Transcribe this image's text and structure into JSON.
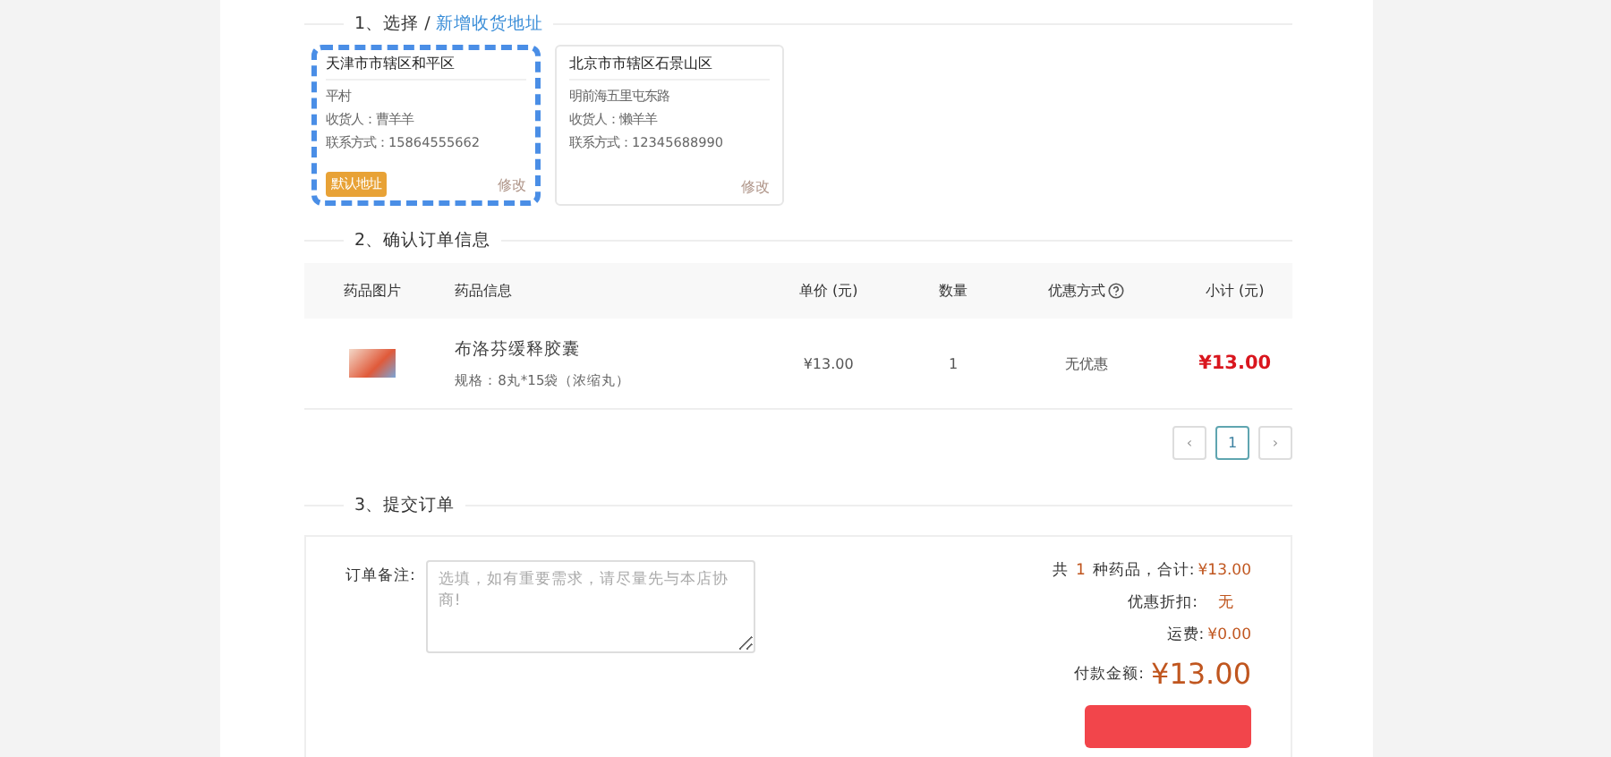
{
  "address_section": {
    "title": "1、选择 /",
    "add_link": "新增收货地址",
    "addresses": [
      {
        "region": "天津市市辖区和平区",
        "detail": "平村",
        "receiver": "收货人：曹羊羊",
        "phone": "联系方式：15864555662",
        "default_badge": "默认地址",
        "edit": "修改",
        "selected": true
      },
      {
        "region": "北京市市辖区石景山区",
        "detail": "明前海五里屯东路",
        "receiver": "收货人：懒羊羊",
        "phone": "联系方式：12345688990",
        "edit": "修改",
        "selected": false
      }
    ]
  },
  "order_section": {
    "title": "2、确认订单信息",
    "columns": [
      "药品图片",
      "药品信息",
      "单价 (元)",
      "数量",
      "优惠方式",
      "小计 (元)"
    ],
    "rows": [
      {
        "name": "布洛芬缓释胶囊",
        "spec": "规格：8丸*15袋（浓缩丸）",
        "price": "¥13.00",
        "quantity": "1",
        "discount": "无优惠",
        "subtotal": "¥13.00"
      }
    ],
    "pagination": {
      "prev": "‹",
      "pages": [
        {
          "label": "1",
          "selected": true
        }
      ],
      "next": "›"
    }
  },
  "submit_section": {
    "title": "3、提交订单",
    "remark_label": "订单备注:",
    "remark_placeholder": "选填，如有重要需求，请尽量先与本店协商!",
    "summary_prefix": "共",
    "count": "1",
    "summary_mid": "种药品，合计:",
    "total": "¥13.00",
    "discount_label": "优惠折扣:",
    "discount_value": "无",
    "shipping_label": "运费:",
    "shipping_value": "¥0.00",
    "pay_label": "付款金额:",
    "pay_value": "¥13.00"
  }
}
